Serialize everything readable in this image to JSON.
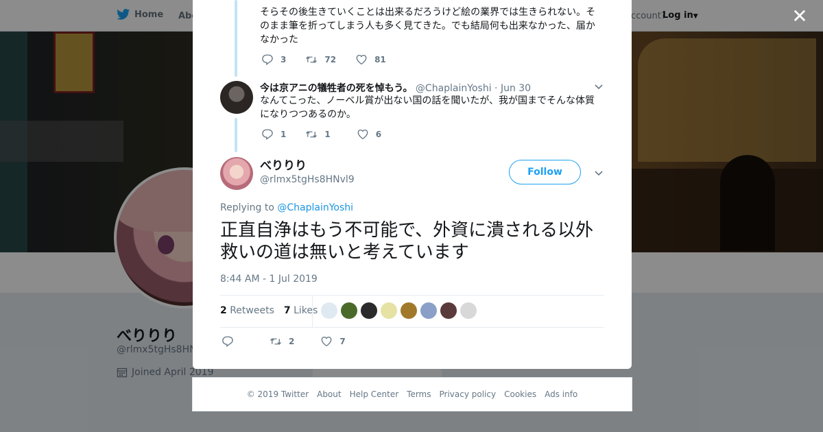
{
  "nav": {
    "home_label": "Home",
    "about_label": "Abo",
    "account_prompt": "ccount?",
    "login_label": "Log in"
  },
  "profile": {
    "name": "べりりり",
    "handle": "@rlmx5tgHs8HNv",
    "joined": "Joined April 2019"
  },
  "thread": [
    {
      "text_partial": "そらその後生きていくことは出来るだろうけど絵の業界では生きられない。そのまま筆を折ってしまう人も多く見てきた。でも結局何も出来なかった、届かなかった",
      "replies": "3",
      "retweets": "72",
      "likes": "81"
    },
    {
      "display_name": "今は京アニの犠牲者の死を悼もう。",
      "handle": "@ChaplainYoshi",
      "date": "· Jun 30",
      "text": "なんてこった、ノーベル賞が出ない国の話を聞いたが、我が国までそんな体質になりつつあるのか。",
      "replies": "1",
      "retweets": "1",
      "likes": "6"
    }
  ],
  "main_tweet": {
    "display_name": "べりりり",
    "handle": "@rlmx5tgHs8HNvl9",
    "follow_label": "Follow",
    "replying_prefix": "Replying to",
    "replying_to": "@ChaplainYoshi",
    "text": "正直自浄はもう不可能で、外資に潰される以外救いの道は無いと考えています",
    "timestamp": "8:44 AM - 1 Jul 2019",
    "retweet_count": "2",
    "retweet_label": "Retweets",
    "like_count": "7",
    "like_label": "Likes",
    "action_retweets": "2",
    "action_likes": "7"
  },
  "likers": [
    {
      "name": "liker-1",
      "color": "#dfe9f2"
    },
    {
      "name": "liker-2",
      "color": "#4a6a2a"
    },
    {
      "name": "liker-3",
      "color": "#2b2b2b"
    },
    {
      "name": "liker-4",
      "color": "#e6e2a4"
    },
    {
      "name": "liker-5",
      "color": "#a07a2a"
    },
    {
      "name": "liker-6",
      "color": "#8aa0c8"
    },
    {
      "name": "liker-7",
      "color": "#5a3a3a"
    },
    {
      "name": "liker-8",
      "color": "#d8d8d8"
    }
  ],
  "footer": [
    "© 2019 Twitter",
    "About",
    "Help Center",
    "Terms",
    "Privacy policy",
    "Cookies",
    "Ads info"
  ],
  "colors": {
    "accent": "#1da1f2",
    "link": "#1b95e0",
    "thread_line": "#c4e3f5"
  }
}
